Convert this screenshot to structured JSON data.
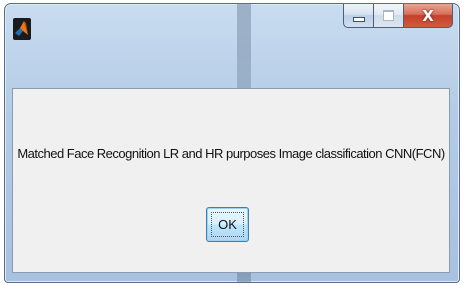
{
  "window": {
    "close_glyph": "X",
    "icon_name": "matlab-logo-icon"
  },
  "dialog": {
    "message": "Matched Face Recognition LR and HR purposes Image classification CNN(FCN)",
    "ok_label": "OK"
  },
  "colors": {
    "close_button": "#c2412a",
    "client_background": "#f0f0f0",
    "ok_button_border": "#3c7fb1"
  }
}
